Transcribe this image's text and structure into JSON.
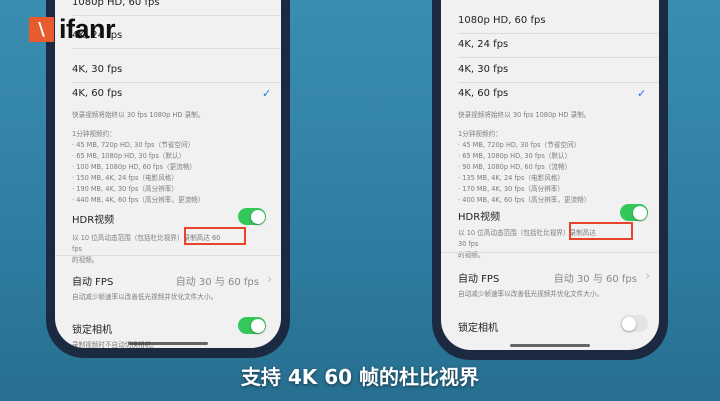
{
  "brand": {
    "name": "ifanr"
  },
  "subtitle": "支持 4K 60 帧的杜比视界",
  "left_phone": {
    "resolutions": [
      "1080p HD, 60 fps",
      "4K, 24 fps",
      "4K, 30 fps",
      "4K, 60 fps"
    ],
    "selected": "4K, 60 fps",
    "note_top": "快录视频将始终以 30 fps 1080p HD 录制。",
    "sizes_title": "1分钟视频约：",
    "sizes": [
      "· 45 MB, 720p HD, 30 fps（节省空间）",
      "· 65 MB, 1080p HD, 30 fps（默认）",
      "· 100 MB, 1080p HD, 60 fps（更流畅）",
      "· 150 MB, 4K, 24 fps（电影风格）",
      "· 190 MB, 4K, 30 fps（高分辨率）",
      "· 440 MB, 4K, 60 fps（高分辨率，更流畅）"
    ],
    "hdr_label": "HDR视频",
    "hdr_on": true,
    "hdr_note_a": "以 10 位高动态范围（包括杜比视界",
    "hdr_note_b": "）录制高达 60 fps",
    "hdr_note_c": "的视频。",
    "auto_fps_label": "自动 FPS",
    "auto_fps_value": "自动 30 与 60 fps",
    "auto_fps_note": "自动减少帧速率以改善低光视频并优化文件大小。",
    "lock_label": "锁定相机",
    "lock_on": true,
    "lock_note": "录制视频时不自动切换相机。"
  },
  "right_phone": {
    "resolutions": [
      "1080p HD, 60 fps",
      "4K, 24 fps",
      "4K, 30 fps",
      "4K, 60 fps"
    ],
    "selected": "4K, 60 fps",
    "note_top": "快录视频将始终以 30 fps 1080p HD 录制。",
    "sizes_title": "1分钟视频约：",
    "sizes": [
      "· 45 MB, 720p HD, 30 fps（节省空间）",
      "· 65 MB, 1080p HD, 30 fps（默认）",
      "· 90 MB, 1080p HD, 60 fps（流畅）",
      "· 135 MB, 4K, 24 fps（电影风格）",
      "· 170 MB, 4K, 30 fps（高分辨率）",
      "· 400 MB, 4K, 60 fps（高分辨率，更流畅）"
    ],
    "hdr_label": "HDR视频",
    "hdr_on": true,
    "hdr_note_a": "以 10 位高动态范围（包括杜比视界）",
    "hdr_note_b": "录制高达 30 fps",
    "hdr_note_c": "的视频。",
    "auto_fps_label": "自动 FPS",
    "auto_fps_value": "自动 30 与 60 fps",
    "auto_fps_note": "自动减少帧速率以改善低光视频并优化文件大小。",
    "lock_label": "锁定相机",
    "lock_on": false
  },
  "icons": {
    "check": "checkmark-icon",
    "chevron": "chevron-right-icon"
  },
  "colors": {
    "toggle_on": "#34c759",
    "highlight": "#e8442c",
    "brand": "#e65c2e"
  }
}
